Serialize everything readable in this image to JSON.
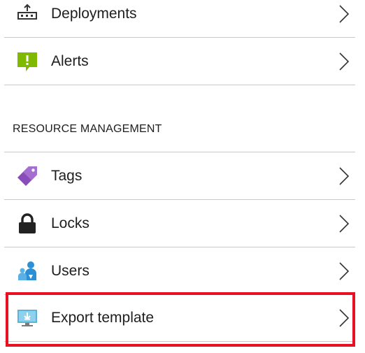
{
  "menu": {
    "items_top": [
      {
        "label": "Deployments",
        "icon": "deployments-icon"
      },
      {
        "label": "Alerts",
        "icon": "alert-icon"
      }
    ],
    "section_header": "RESOURCE MANAGEMENT",
    "items_resource": [
      {
        "label": "Tags",
        "icon": "tag-icon"
      },
      {
        "label": "Locks",
        "icon": "lock-icon"
      },
      {
        "label": "Users",
        "icon": "users-icon"
      },
      {
        "label": "Export template",
        "icon": "export-template-icon"
      }
    ]
  },
  "colors": {
    "divider": "#c8c8c8",
    "alert_green": "#7fba00",
    "tag_purple": "#8a4cb8",
    "users_blue": "#2d8fd5",
    "export_blue": "#59b4d9",
    "highlight_red": "#e81123"
  }
}
